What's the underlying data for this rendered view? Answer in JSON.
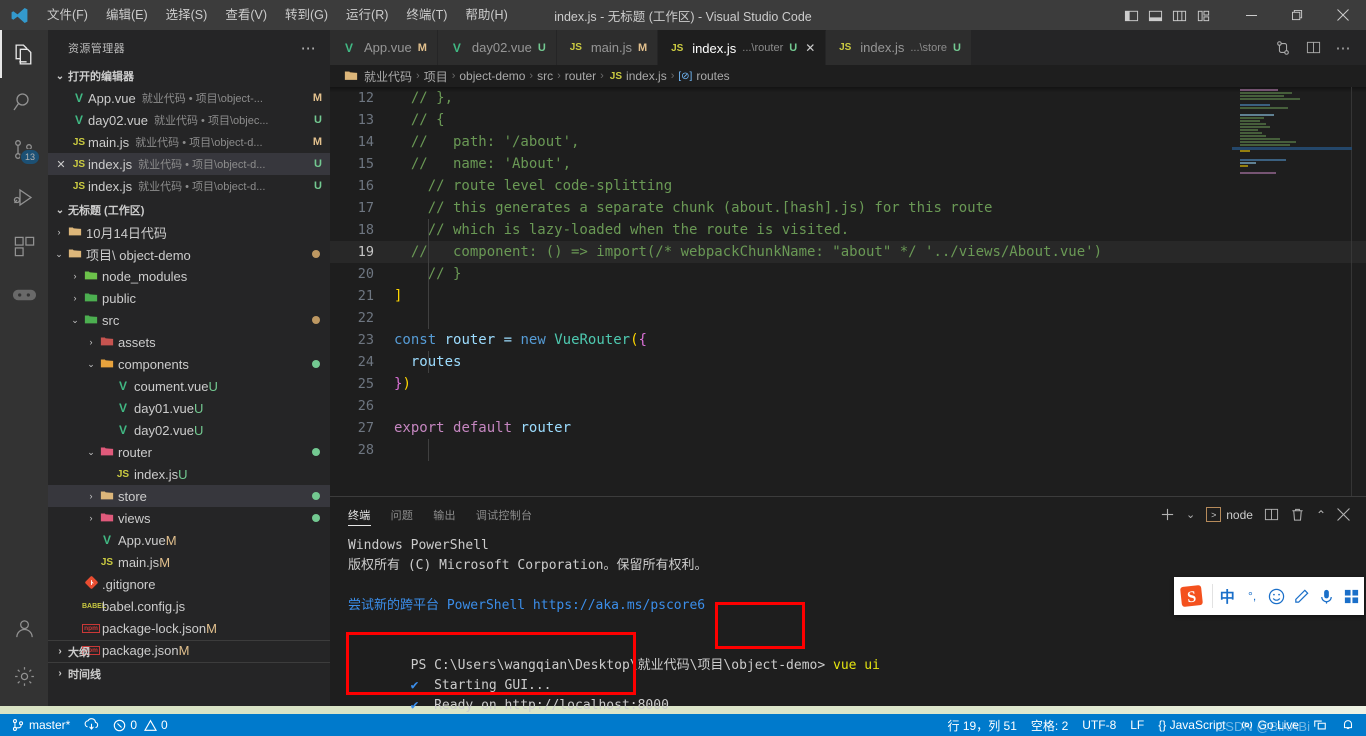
{
  "titlebar": {
    "menus": [
      "文件(F)",
      "编辑(E)",
      "选择(S)",
      "查看(V)",
      "转到(G)",
      "运行(R)",
      "终端(T)",
      "帮助(H)"
    ],
    "title": "index.js - 无标题 (工作区) - Visual Studio Code",
    "layout_icons": [
      "toggle-primary-sidebar-icon",
      "toggle-panel-icon",
      "toggle-secondary-sidebar-icon",
      "customize-layout-icon"
    ],
    "window_controls": {
      "minimize": "—",
      "maximize": "❐",
      "close": "✕"
    }
  },
  "activitybar": {
    "items": [
      {
        "name": "explorer",
        "icon": "files-icon",
        "active": true,
        "badge": ""
      },
      {
        "name": "search",
        "icon": "search-icon",
        "active": false,
        "badge": ""
      },
      {
        "name": "source-control",
        "icon": "source-control-icon",
        "active": false,
        "badge": "13"
      },
      {
        "name": "run-and-debug",
        "icon": "debug-icon",
        "active": false,
        "badge": ""
      },
      {
        "name": "extensions",
        "icon": "extensions-icon",
        "active": false,
        "badge": ""
      },
      {
        "name": "game",
        "icon": "gamepad-icon",
        "active": false,
        "badge": ""
      }
    ],
    "bottom": [
      {
        "name": "accounts",
        "icon": "account-icon"
      },
      {
        "name": "manage",
        "icon": "gear-icon"
      }
    ]
  },
  "sidebar": {
    "header_title": "资源管理器",
    "header_more": "⋯",
    "open_editors": {
      "label": "打开的编辑器",
      "items": [
        {
          "icon": "vue",
          "name": "App.vue",
          "desc": "就业代码 • 项目\\object-...",
          "badge": "M",
          "selected": false,
          "closable": false
        },
        {
          "icon": "vue",
          "name": "day02.vue",
          "desc": "就业代码 • 项目\\objec...",
          "badge": "U",
          "selected": false,
          "closable": false
        },
        {
          "icon": "js",
          "name": "main.js",
          "desc": "就业代码 • 项目\\object-d...",
          "badge": "M",
          "selected": false,
          "closable": false
        },
        {
          "icon": "js",
          "name": "index.js",
          "desc": "就业代码 • 项目\\object-d...",
          "badge": "U",
          "selected": true,
          "closable": true
        },
        {
          "icon": "js",
          "name": "index.js",
          "desc": "就业代码 • 项目\\object-d...",
          "badge": "U",
          "selected": false,
          "closable": false
        }
      ]
    },
    "workspace": {
      "label": "无标题 (工作区)",
      "tree": [
        {
          "depth": 1,
          "twisty": "collapsed",
          "icon": "folder",
          "label": "10月14日代码",
          "badge": "",
          "dot": "",
          "selected": false
        },
        {
          "depth": 1,
          "twisty": "expanded",
          "icon": "folder",
          "label": "项目\\ object-demo",
          "badge": "",
          "dot": "amber",
          "selected": false
        },
        {
          "depth": 2,
          "twisty": "collapsed",
          "icon": "folder-node",
          "label": "node_modules",
          "badge": "",
          "dot": "",
          "selected": false
        },
        {
          "depth": 2,
          "twisty": "collapsed",
          "icon": "folder-public",
          "label": "public",
          "badge": "",
          "dot": "",
          "selected": false
        },
        {
          "depth": 2,
          "twisty": "expanded",
          "icon": "folder-src",
          "label": "src",
          "badge": "",
          "dot": "amber",
          "selected": false
        },
        {
          "depth": 3,
          "twisty": "collapsed",
          "icon": "folder-assets",
          "label": "assets",
          "badge": "",
          "dot": "",
          "selected": false
        },
        {
          "depth": 3,
          "twisty": "expanded",
          "icon": "folder-comp",
          "label": "components",
          "badge": "",
          "dot": "green",
          "selected": false
        },
        {
          "depth": 4,
          "twisty": "none",
          "icon": "vue",
          "label": "coument.vue",
          "badge": "U",
          "dot": "",
          "selected": false
        },
        {
          "depth": 4,
          "twisty": "none",
          "icon": "vue",
          "label": "day01.vue",
          "badge": "U",
          "dot": "",
          "selected": false
        },
        {
          "depth": 4,
          "twisty": "none",
          "icon": "vue",
          "label": "day02.vue",
          "badge": "U",
          "dot": "",
          "selected": false
        },
        {
          "depth": 3,
          "twisty": "expanded",
          "icon": "folder-router",
          "label": "router",
          "badge": "",
          "dot": "green",
          "selected": false
        },
        {
          "depth": 4,
          "twisty": "none",
          "icon": "js",
          "label": "index.js",
          "badge": "U",
          "dot": "",
          "selected": false
        },
        {
          "depth": 3,
          "twisty": "collapsed",
          "icon": "folder",
          "label": "store",
          "badge": "",
          "dot": "green",
          "selected": true
        },
        {
          "depth": 3,
          "twisty": "collapsed",
          "icon": "folder-views",
          "label": "views",
          "badge": "",
          "dot": "green",
          "selected": false
        },
        {
          "depth": 3,
          "twisty": "none",
          "icon": "vue",
          "label": "App.vue",
          "badge": "M",
          "dot": "",
          "selected": false
        },
        {
          "depth": 3,
          "twisty": "none",
          "icon": "js",
          "label": "main.js",
          "badge": "M",
          "dot": "",
          "selected": false
        },
        {
          "depth": 2,
          "twisty": "none",
          "icon": "git",
          "label": ".gitignore",
          "badge": "",
          "dot": "",
          "selected": false
        },
        {
          "depth": 2,
          "twisty": "none",
          "icon": "babel",
          "label": "babel.config.js",
          "badge": "",
          "dot": "",
          "selected": false
        },
        {
          "depth": 2,
          "twisty": "none",
          "icon": "npm",
          "label": "package-lock.json",
          "badge": "M",
          "dot": "",
          "selected": false
        },
        {
          "depth": 2,
          "twisty": "none",
          "icon": "npm",
          "label": "package.json",
          "badge": "M",
          "dot": "",
          "selected": false
        }
      ]
    },
    "bottom_sections": [
      "大纲",
      "时间线"
    ]
  },
  "editor": {
    "tabs": [
      {
        "icon": "vue",
        "name": "App.vue",
        "desc": "",
        "badge": "M",
        "active": false,
        "closable": false
      },
      {
        "icon": "vue",
        "name": "day02.vue",
        "desc": "",
        "badge": "U",
        "active": false,
        "closable": false
      },
      {
        "icon": "js",
        "name": "main.js",
        "desc": "",
        "badge": "M",
        "active": false,
        "closable": false
      },
      {
        "icon": "js",
        "name": "index.js",
        "desc": "...\\router",
        "badge": "U",
        "active": true,
        "closable": true
      },
      {
        "icon": "js",
        "name": "index.js",
        "desc": "...\\store",
        "badge": "U",
        "active": false,
        "closable": false
      }
    ],
    "actions": [
      "split-editor-right-icon",
      "split-editor-icon",
      "more-actions-icon"
    ],
    "breadcrumb": [
      "就业代码",
      "项目",
      "object-demo",
      "src",
      "router",
      "index.js",
      "routes"
    ],
    "breadcrumb_symbol": "routes",
    "code_lines": [
      {
        "num": "12",
        "text": "  // },",
        "type": "comment",
        "current": false
      },
      {
        "num": "13",
        "text": "  // {",
        "type": "comment",
        "current": false
      },
      {
        "num": "14",
        "text": "  //   path: '/about',",
        "type": "comment",
        "current": false
      },
      {
        "num": "15",
        "text": "  //   name: 'About',",
        "type": "comment",
        "current": false
      },
      {
        "num": "16",
        "text": "    // route level code-splitting",
        "type": "comment",
        "current": false
      },
      {
        "num": "17",
        "text": "    // this generates a separate chunk (about.[hash].js) for this route",
        "type": "comment",
        "current": false
      },
      {
        "num": "18",
        "text": "    // which is lazy-loaded when the route is visited.",
        "type": "comment",
        "current": false
      },
      {
        "num": "19",
        "text": "  //   component: () => import(/* webpackChunkName: \"about\" */ '../views/About.vue')",
        "type": "comment",
        "current": true
      },
      {
        "num": "20",
        "text": "    // }",
        "type": "comment",
        "current": false
      },
      {
        "num": "21",
        "text": "]",
        "type": "bracket",
        "current": false
      },
      {
        "num": "22",
        "text": "",
        "type": "empty",
        "current": false
      },
      {
        "num": "23",
        "text": "const router = new VueRouter({",
        "type": "code-router",
        "current": false
      },
      {
        "num": "24",
        "text": "  routes",
        "type": "code-routes",
        "current": false
      },
      {
        "num": "25",
        "text": "})",
        "type": "code-close",
        "current": false
      },
      {
        "num": "26",
        "text": "",
        "type": "empty",
        "current": false
      },
      {
        "num": "27",
        "text": "export default router",
        "type": "code-export",
        "current": false
      },
      {
        "num": "28",
        "text": "",
        "type": "empty",
        "current": false
      }
    ]
  },
  "panel": {
    "tabs": [
      "终端",
      "问题",
      "输出",
      "调试控制台"
    ],
    "active_tab": "终端",
    "actions": {
      "new_terminal": "＋",
      "dropdown": "⌄",
      "terminal_name": "node",
      "split": "split-terminal-icon",
      "kill": "trash-icon",
      "maximize": "chevron-up-icon",
      "close": "close-icon"
    },
    "terminal_lines": [
      {
        "text": "Windows PowerShell",
        "style": "plain"
      },
      {
        "text": "版权所有 (C) Microsoft Corporation。保留所有权利。",
        "style": "plain"
      },
      {
        "text": "",
        "style": "plain"
      },
      {
        "text": "尝试新的跨平台 PowerShell https://aka.ms/pscore6",
        "style": "link"
      },
      {
        "text": "",
        "style": "plain"
      }
    ],
    "prompt": "PS C:\\Users\\wangqian\\Desktop\\就业代码\\项目\\object-demo>",
    "command": "vue ui",
    "output": [
      {
        "mark": "✔",
        "text": "Starting GUI..."
      },
      {
        "mark": "✔",
        "text": "Ready on http://localhost:8000"
      }
    ],
    "highlight_color": "#fe0000"
  },
  "statusbar": {
    "left": [
      {
        "icon": "source-control-icon",
        "label": "master*"
      },
      {
        "icon": "sync-icon",
        "label": ""
      },
      {
        "icon": "error-icon",
        "label": "0",
        "icon2": "warning-icon",
        "label2": "0"
      }
    ],
    "branch": "master*",
    "errors": "0",
    "warnings": "0",
    "right": [
      {
        "name": "cursor-position",
        "label": "行 19，列 51"
      },
      {
        "name": "indentation",
        "label": "空格: 2"
      },
      {
        "name": "encoding",
        "label": "UTF-8"
      },
      {
        "name": "eol",
        "label": "LF"
      },
      {
        "name": "language-mode",
        "label": "{} JavaScript"
      },
      {
        "name": "go-live",
        "label": "Go Live"
      },
      {
        "name": "remote",
        "label": ""
      },
      {
        "name": "bell",
        "label": ""
      }
    ],
    "watermark": "CSDN @BiKABi"
  },
  "ime": {
    "logo": "S",
    "buttons": [
      "中",
      "°,",
      "☺",
      "✎",
      "🎤",
      "▦"
    ]
  }
}
